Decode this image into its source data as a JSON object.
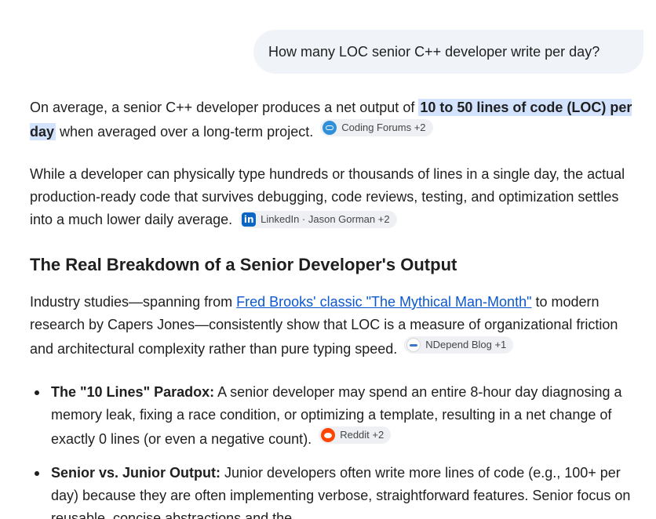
{
  "user_message": "How many LOC senior C++ developer write  per day?",
  "response": {
    "p1": {
      "before": "On average, a senior C++ developer produces a net output of ",
      "highlight": "10 to 50 lines of code (LOC) per day",
      "after": " when averaged over a long-term project.",
      "source": "Coding Forums +2",
      "source_icon": "forum-icon"
    },
    "p2": {
      "text": "While a developer can physically type hundreds or thousands of lines in a single day, the actual production-ready code that survives debugging, code reviews, testing, and optimization settles into a much lower daily average.",
      "source": "LinkedIn · Jason Gorman +2",
      "source_icon": "linkedin-icon"
    },
    "heading": "The Real Breakdown of a Senior Developer's Output",
    "p3": {
      "before": "Industry studies—spanning from ",
      "link": "Fred Brooks' classic \"The Mythical Man-Month\"",
      "after": " to modern research by Capers Jones—consistently show that LOC is a measure of organizational friction and architectural complexity rather than pure typing speed.",
      "source": "NDepend Blog +1",
      "source_icon": "ndepend-icon"
    },
    "bullets": [
      {
        "title": "The \"10 Lines\" Paradox:",
        "text": " A senior developer may spend an entire 8-hour day diagnosing a memory leak, fixing a race condition, or optimizing a template, resulting in a net change of exactly 0 lines (or even a negative count).",
        "source": "Reddit +2",
        "source_icon": "reddit-icon"
      },
      {
        "title": "Senior vs. Junior Output:",
        "text": " Junior developers often write more lines of code (e.g., 100+ per day) because they are often implementing verbose, straightforward features. Senior focus on reusable, concise abstractions and the"
      }
    ]
  }
}
